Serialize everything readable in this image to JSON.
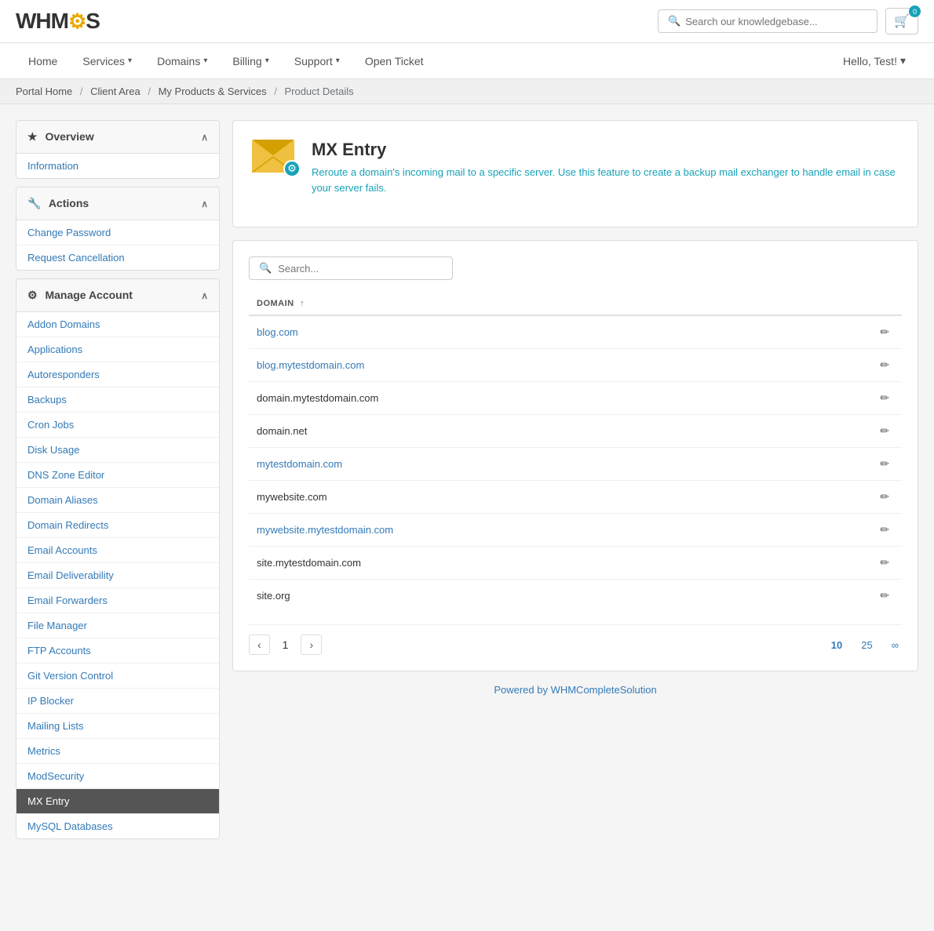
{
  "logo": {
    "text_wh": "WHM",
    "gear": "⚙",
    "text_cs": "S"
  },
  "topbar": {
    "search_placeholder": "Search our knowledgebase...",
    "cart_count": "0",
    "hello": "Hello, Test!",
    "hello_arrow": "▾"
  },
  "nav": {
    "items": [
      {
        "label": "Home",
        "has_dropdown": false
      },
      {
        "label": "Services",
        "has_dropdown": true
      },
      {
        "label": "Domains",
        "has_dropdown": true
      },
      {
        "label": "Billing",
        "has_dropdown": true
      },
      {
        "label": "Support",
        "has_dropdown": true
      },
      {
        "label": "Open Ticket",
        "has_dropdown": false
      }
    ]
  },
  "breadcrumb": {
    "items": [
      {
        "label": "Portal Home",
        "link": true
      },
      {
        "label": "Client Area",
        "link": true
      },
      {
        "label": "My Products & Services",
        "link": true
      },
      {
        "label": "Product Details",
        "link": false
      }
    ]
  },
  "sidebar": {
    "overview_label": "Overview",
    "overview_icon": "★",
    "overview_chevron": "∧",
    "overview_items": [
      {
        "label": "Information",
        "active": false
      }
    ],
    "actions_label": "Actions",
    "actions_icon": "🔧",
    "actions_chevron": "∧",
    "actions_items": [
      {
        "label": "Change Password",
        "active": false
      },
      {
        "label": "Request Cancellation",
        "active": false
      }
    ],
    "manage_label": "Manage Account",
    "manage_icon": "⚙",
    "manage_chevron": "∧",
    "manage_items": [
      {
        "label": "Addon Domains",
        "active": false
      },
      {
        "label": "Applications",
        "active": false
      },
      {
        "label": "Autoresponders",
        "active": false
      },
      {
        "label": "Backups",
        "active": false
      },
      {
        "label": "Cron Jobs",
        "active": false
      },
      {
        "label": "Disk Usage",
        "active": false
      },
      {
        "label": "DNS Zone Editor",
        "active": false
      },
      {
        "label": "Domain Aliases",
        "active": false
      },
      {
        "label": "Domain Redirects",
        "active": false
      },
      {
        "label": "Email Accounts",
        "active": false
      },
      {
        "label": "Email Deliverability",
        "active": false
      },
      {
        "label": "Email Forwarders",
        "active": false
      },
      {
        "label": "File Manager",
        "active": false
      },
      {
        "label": "FTP Accounts",
        "active": false
      },
      {
        "label": "Git Version Control",
        "active": false
      },
      {
        "label": "IP Blocker",
        "active": false
      },
      {
        "label": "Mailing Lists",
        "active": false
      },
      {
        "label": "Metrics",
        "active": false
      },
      {
        "label": "ModSecurity",
        "active": false
      },
      {
        "label": "MX Entry",
        "active": true
      },
      {
        "label": "MySQL Databases",
        "active": false
      }
    ]
  },
  "product": {
    "title": "MX Entry",
    "description": "Reroute a domain's incoming mail to a specific server. Use this feature to create a backup mail exchanger to handle email in case your server fails."
  },
  "table": {
    "search_placeholder": "Search...",
    "col_domain": "DOMAIN",
    "col_sort_arrow": "↑",
    "rows": [
      {
        "domain": "blog.com",
        "is_link": true
      },
      {
        "domain": "blog.mytestdomain.com",
        "is_link": true
      },
      {
        "domain": "domain.mytestdomain.com",
        "is_link": false
      },
      {
        "domain": "domain.net",
        "is_link": false
      },
      {
        "domain": "mytestdomain.com",
        "is_link": true
      },
      {
        "domain": "mywebsite.com",
        "is_link": false
      },
      {
        "domain": "mywebsite.mytestdomain.com",
        "is_link": true
      },
      {
        "domain": "site.mytestdomain.com",
        "is_link": false
      },
      {
        "domain": "site.org",
        "is_link": false
      }
    ],
    "pagination": {
      "prev": "‹",
      "next": "›",
      "current_page": "1",
      "sizes": [
        "10",
        "25",
        "∞"
      ]
    }
  },
  "footer": {
    "text": "Powered by WHMCompleteSolution"
  }
}
